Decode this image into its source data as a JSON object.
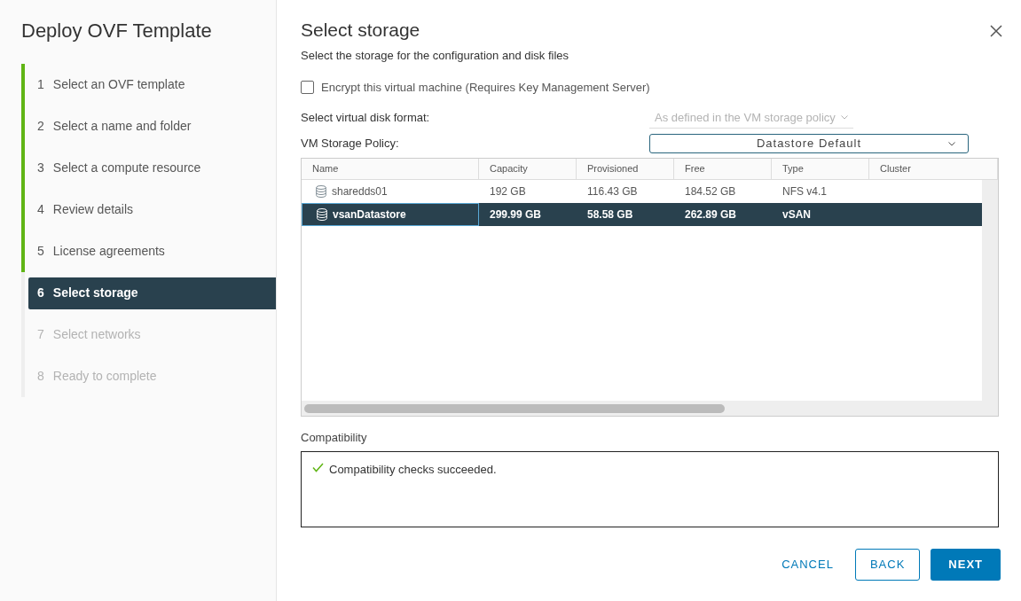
{
  "wizard": {
    "title": "Deploy OVF Template"
  },
  "steps": [
    {
      "number": "1",
      "label": "Select an OVF template",
      "completed": true,
      "disabled": false,
      "selected": false
    },
    {
      "number": "2",
      "label": "Select a name and folder",
      "completed": true,
      "disabled": false,
      "selected": false
    },
    {
      "number": "3",
      "label": "Select a compute resource",
      "completed": true,
      "disabled": false,
      "selected": false
    },
    {
      "number": "4",
      "label": "Review details",
      "completed": true,
      "disabled": false,
      "selected": false
    },
    {
      "number": "5",
      "label": "License agreements",
      "completed": true,
      "disabled": false,
      "selected": false
    },
    {
      "number": "6",
      "label": "Select storage",
      "completed": false,
      "disabled": false,
      "selected": true
    },
    {
      "number": "7",
      "label": "Select networks",
      "completed": false,
      "disabled": true,
      "selected": false
    },
    {
      "number": "8",
      "label": "Ready to complete",
      "completed": false,
      "disabled": true,
      "selected": false
    }
  ],
  "page": {
    "title": "Select storage",
    "subtitle": "Select the storage for the configuration and disk files"
  },
  "encrypt": {
    "label": "Encrypt this virtual machine (Requires Key Management Server)",
    "checked": false
  },
  "disk_format": {
    "label": "Select virtual disk format:",
    "value": "As defined in the VM storage policy",
    "disabled": true
  },
  "storage_policy": {
    "label": "VM Storage Policy:",
    "value": "Datastore Default"
  },
  "table": {
    "columns": [
      "Name",
      "Capacity",
      "Provisioned",
      "Free",
      "Type",
      "Cluster"
    ],
    "rows": [
      {
        "cells": [
          "sharedds01",
          "192 GB",
          "116.43 GB",
          "184.52 GB",
          "NFS v4.1"
        ],
        "selected": false
      },
      {
        "cells": [
          "vsanDatastore",
          "299.99 GB",
          "58.58 GB",
          "262.89 GB",
          "vSAN"
        ],
        "selected": true
      }
    ]
  },
  "compatibility": {
    "label": "Compatibility",
    "message": "Compatibility checks succeeded."
  },
  "buttons": [
    {
      "label": "CANCEL",
      "kind": "link"
    },
    {
      "label": "BACK",
      "kind": "outline"
    },
    {
      "label": "NEXT",
      "kind": "primary"
    }
  ]
}
